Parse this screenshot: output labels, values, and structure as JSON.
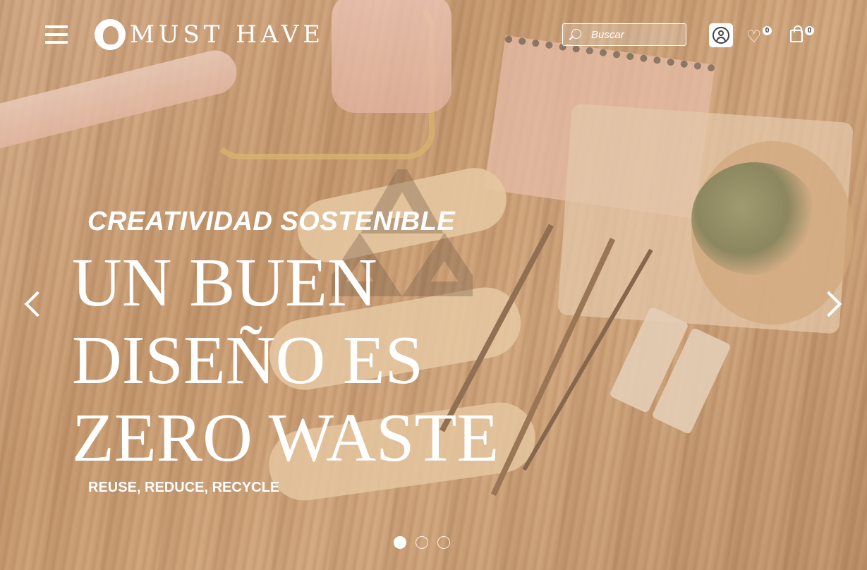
{
  "header": {
    "menu_icon": "hamburger-menu-icon",
    "logo_text": "MUST HAVE",
    "search": {
      "placeholder": "Buscar",
      "value": "",
      "icon": "search-icon"
    },
    "account_icon": "user-icon",
    "wishlist": {
      "icon": "heart-icon",
      "count": "0"
    },
    "cart": {
      "icon": "shopping-bag-icon",
      "count": "0"
    }
  },
  "hero": {
    "kicker": "CREATIVIDAD SOSTENIBLE",
    "headline_lines": [
      "UN BUEN",
      "DISEÑO ES",
      "ZERO WASTE"
    ],
    "tagline": "REUSE, REDUCE, RECYCLE"
  },
  "carousel": {
    "prev_icon": "chevron-left-icon",
    "next_icon": "chevron-right-icon",
    "slide_count": 3,
    "active_index": 0
  },
  "colors": {
    "text": "#ffffff",
    "background_wood": "#b9885a"
  }
}
